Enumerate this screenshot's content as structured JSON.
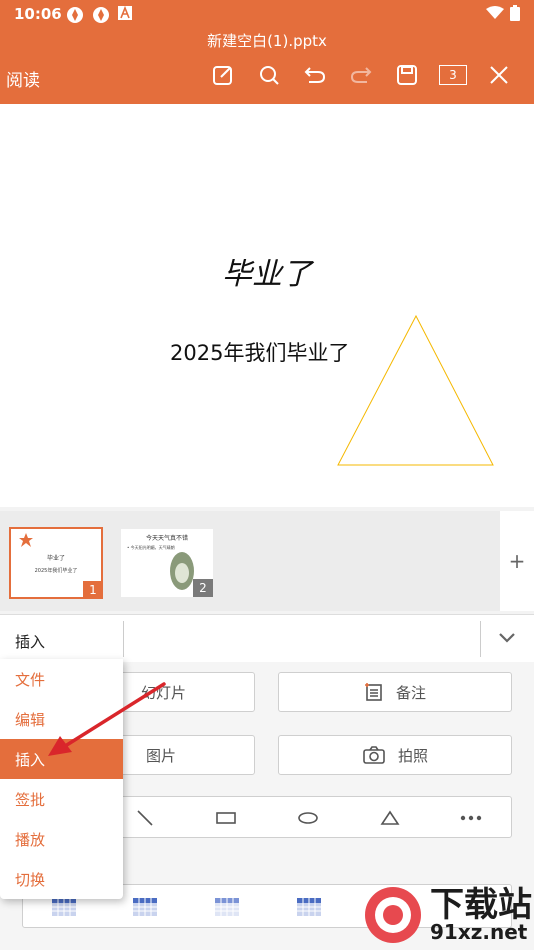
{
  "status": {
    "time": "10:06"
  },
  "header": {
    "title": "新建空白(1).pptx",
    "read_label": "阅读",
    "page_count": "3"
  },
  "slide": {
    "title": "毕业了",
    "subtitle": "2025年我们毕业了"
  },
  "thumbnails": [
    {
      "number": "1",
      "title": "毕业了",
      "subtitle": "2025年我们毕业了"
    },
    {
      "number": "2",
      "title": "今天天气真不错",
      "bullet": "• 今天阳光明媚，天气晴朗"
    }
  ],
  "add_slide_label": "+",
  "tabbar": {
    "current": "插入"
  },
  "panel": {
    "slide_label": "幻灯片",
    "notes_label": "备注",
    "picture_label": "图片",
    "photo_label": "拍照"
  },
  "menu": [
    "文件",
    "编辑",
    "插入",
    "签批",
    "播放",
    "切换"
  ],
  "menu_active_index": 2,
  "watermark": {
    "main": "下载站",
    "sub": "91xz.net"
  },
  "colors": {
    "accent": "#e46e3c",
    "arrow": "#d9262b"
  }
}
